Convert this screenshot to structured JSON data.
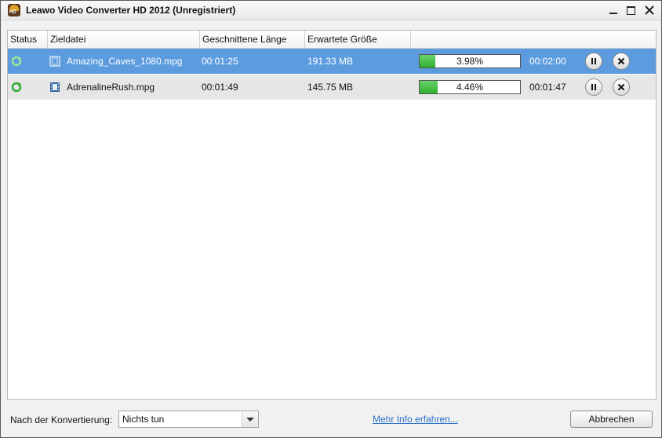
{
  "window": {
    "title": "Leawo Video Converter HD 2012 (Unregistriert)"
  },
  "table": {
    "columns": [
      "Status",
      "Zieldatei",
      "Geschnittene Länge",
      "Erwartete Größe",
      ""
    ],
    "rows": [
      {
        "file": "Amazing_Caves_1080.mpg",
        "length": "00:01:25",
        "size": "191.33 MB",
        "progress": 3.98,
        "progress_text": "3.98%",
        "remaining": "00:02:00",
        "selected": true
      },
      {
        "file": "AdrenalineRush.mpg",
        "length": "00:01:49",
        "size": "145.75 MB",
        "progress": 4.46,
        "progress_text": "4.46%",
        "remaining": "00:01:47",
        "selected": false
      }
    ]
  },
  "footer": {
    "after_label": "Nach der Konvertierung:",
    "after_value": "Nichts tun",
    "more_info": "Mehr Info erfahren...",
    "cancel": "Abbrechen"
  },
  "icons": {
    "status": "converting-refresh-icon",
    "file": "film-icon",
    "pause": "pause-icon",
    "remove": "close-icon"
  },
  "colors": {
    "selection": "#5b9bde",
    "progress": "#3dbb3d",
    "link": "#2a6fc9"
  }
}
